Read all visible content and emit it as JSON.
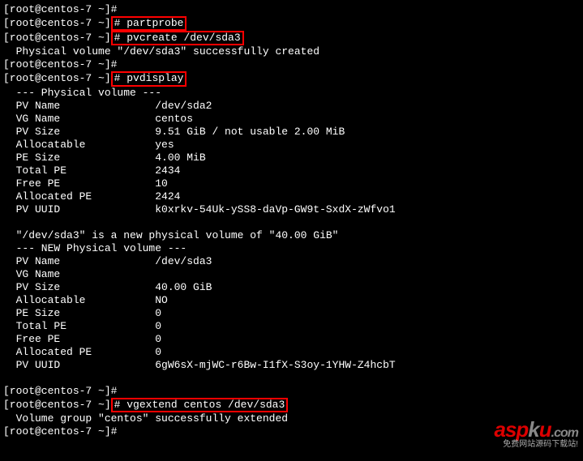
{
  "prompt1": "[root@centos-7 ~]#",
  "prompt2": "[root@centos-7 ~]",
  "hash": "#",
  "cmd1": " partprobe",
  "cmd2": " pvcreate /dev/sda3",
  "out_pvcreate": "  Physical volume \"/dev/sda3\" successfully created",
  "cmd3": " pvdisplay",
  "pv_header": "  --- Physical volume ---",
  "pv1": {
    "name": "  PV Name               /dev/sda2",
    "vg": "  VG Name               centos",
    "size": "  PV Size               9.51 GiB / not usable 2.00 MiB",
    "alloc": "  Allocatable           yes",
    "pesize": "  PE Size               4.00 MiB",
    "totalpe": "  Total PE              2434",
    "freepe": "  Free PE               10",
    "allocpe": "  Allocated PE          2424",
    "uuid": "  PV UUID               k0xrkv-54Uk-ySS8-daVp-GW9t-SxdX-zWfvo1"
  },
  "new_pv_msg": "  \"/dev/sda3\" is a new physical volume of \"40.00 GiB\"",
  "new_pv_header": "  --- NEW Physical volume ---",
  "pv2": {
    "name": "  PV Name               /dev/sda3",
    "vg": "  VG Name               ",
    "size": "  PV Size               40.00 GiB",
    "alloc": "  Allocatable           NO",
    "pesize": "  PE Size               0",
    "totalpe": "  Total PE              0",
    "freepe": "  Free PE               0",
    "allocpe": "  Allocated PE          0",
    "uuid": "  PV UUID               6gW6sX-mjWC-r6Bw-I1fX-S3oy-1YHW-Z4hcbT"
  },
  "cmd4": " vgextend centos /dev/sda3",
  "out_vgextend": "  Volume group \"centos\" successfully extended",
  "watermark": {
    "brand_a": "asp",
    "brand_k": "k",
    "brand_u": "u",
    "brand_com": ".com",
    "sub": "免费网站源码下载站!"
  }
}
